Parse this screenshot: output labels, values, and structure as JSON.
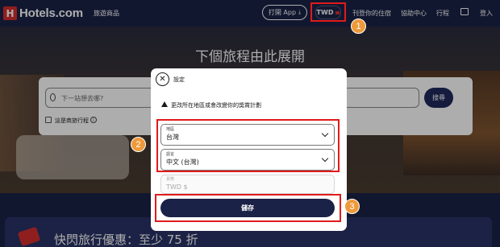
{
  "header": {
    "logo_text": "Hotels.com",
    "logo_mark": "H",
    "travel_link": "旅遊商品",
    "open_app": "打開 App",
    "currency": "TWD",
    "list_property": "刊登你的住宿",
    "help_center": "協助中心",
    "trips": "行程",
    "login": "登入"
  },
  "hero": {
    "title": "下個旅程由此展開"
  },
  "search": {
    "placeholder": "下一站想去哪?",
    "search_button": "搜尋",
    "multi_city_label": "這是商旅行程",
    "info_symbol": "i"
  },
  "promo": {
    "text": "快閃旅行優惠：至少 75 折"
  },
  "modal": {
    "title": "設定",
    "close_symbol": "✕",
    "warning_text": "更改所在地區或會改變你的獎賞計劃",
    "region": {
      "label": "地區",
      "value": "台灣"
    },
    "language": {
      "label": "語言",
      "value": "中文 (台灣)"
    },
    "currency": {
      "label": "貨幣",
      "value": "TWD $"
    },
    "save_button": "儲存"
  },
  "callouts": [
    "1",
    "2",
    "3"
  ],
  "colors": {
    "header_bg": "#1b2247",
    "highlight": "#e01b1b",
    "callout": "#ee9a3c",
    "save_button": "#1b2247"
  }
}
